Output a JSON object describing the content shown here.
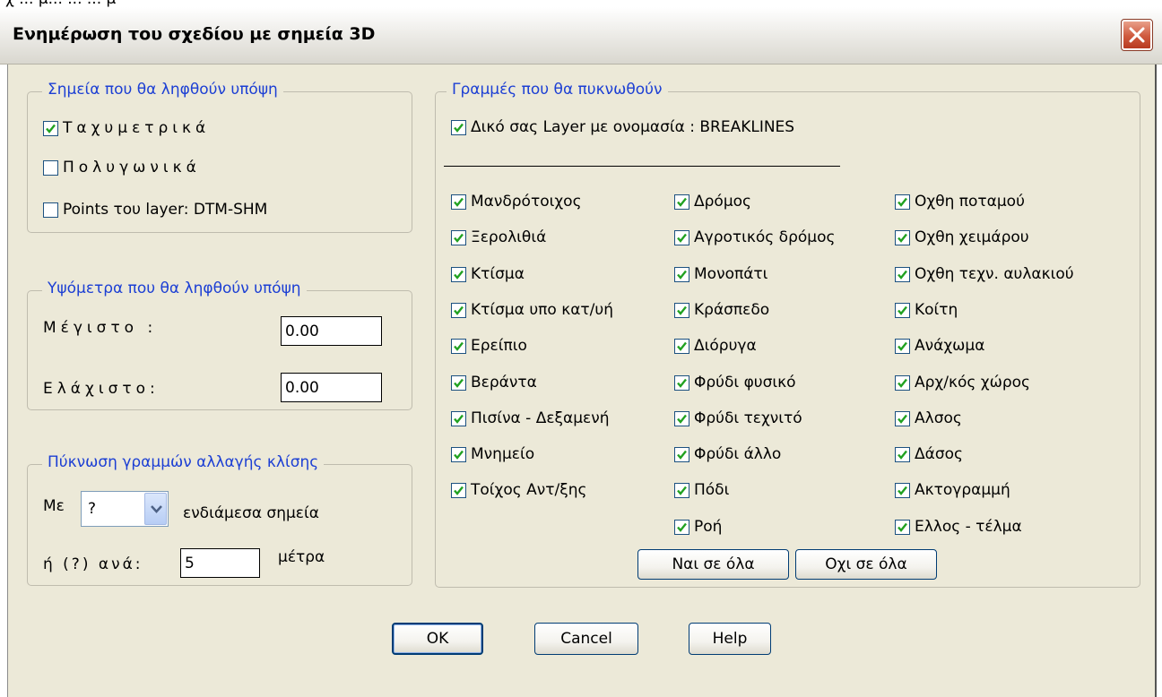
{
  "top_strip_text": "χ ... μ... ... ... μ",
  "window": {
    "title": "Ενημέρωση του σχεδίου με σημεία 3D",
    "close_icon": "close-icon"
  },
  "points_group": {
    "legend": "Σημεία που θα ληφθούν υπόψη",
    "items": [
      {
        "label": "Ταχυμετρικά",
        "checked": true
      },
      {
        "label": "Πολυγωνικά",
        "checked": false
      },
      {
        "label": "Points του layer: DTM-SHM",
        "checked": false
      }
    ]
  },
  "elevations_group": {
    "legend": "Υψόμετρα που θα ληφθούν υπόψη",
    "max_label": "Μέγιστο :",
    "max_value": "0.00",
    "min_label": "Ελάχιστο:",
    "min_value": "0.00"
  },
  "densify_group": {
    "legend": "Πύκνωση γραμμών αλλαγής κλίσης",
    "with_label": "Με",
    "combo_value": "?",
    "points_label": "ενδιάμεσα σημεία",
    "or_label": "ή (?) ανά:",
    "step_value": "5",
    "meters_label": "μέτρα"
  },
  "lines_group": {
    "legend": "Γραμμές που θα πυκνωθούν",
    "own_layer_label": "Δικό σας Layer με ονομασία : BREAKLINES",
    "own_layer_checked": true,
    "col1": [
      "Μανδρότοιχος",
      "Ξερολιθιά",
      "Κτίσμα",
      "Κτίσμα υπο κατ/υή",
      "Ερείπιο",
      "Βεράντα",
      "Πισίνα - Δεξαμενή",
      "Μνημείο",
      "Τοίχος Αντ/ξης"
    ],
    "col2": [
      "Δρόμος",
      "Αγροτικός δρόμος",
      "Μονοπάτι",
      "Κράσπεδο",
      "Διόρυγα",
      "Φρύδι φυσικό",
      "Φρύδι τεχνιτό",
      "Φρύδι άλλο",
      "Πόδι",
      "Ροή"
    ],
    "col3": [
      "Οχθη ποταμού",
      "Οχθη χειμάρου",
      "Οχθη τεχν. αυλακιού",
      "Κοίτη",
      "Ανάχωμα",
      "Αρχ/κός χώρος",
      "Αλσος",
      "Δάσος",
      "Ακτογραμμή",
      "Ελλος - τέλμα"
    ],
    "yes_all_label": "Ναι σε όλα",
    "no_all_label": "Οχι σε όλα"
  },
  "buttons": {
    "ok": "OK",
    "cancel": "Cancel",
    "help": "Help"
  },
  "colors": {
    "dialog_bg": "#ECE9D8",
    "legend_text": "#1c3fd4",
    "check_green": "#21a121"
  }
}
